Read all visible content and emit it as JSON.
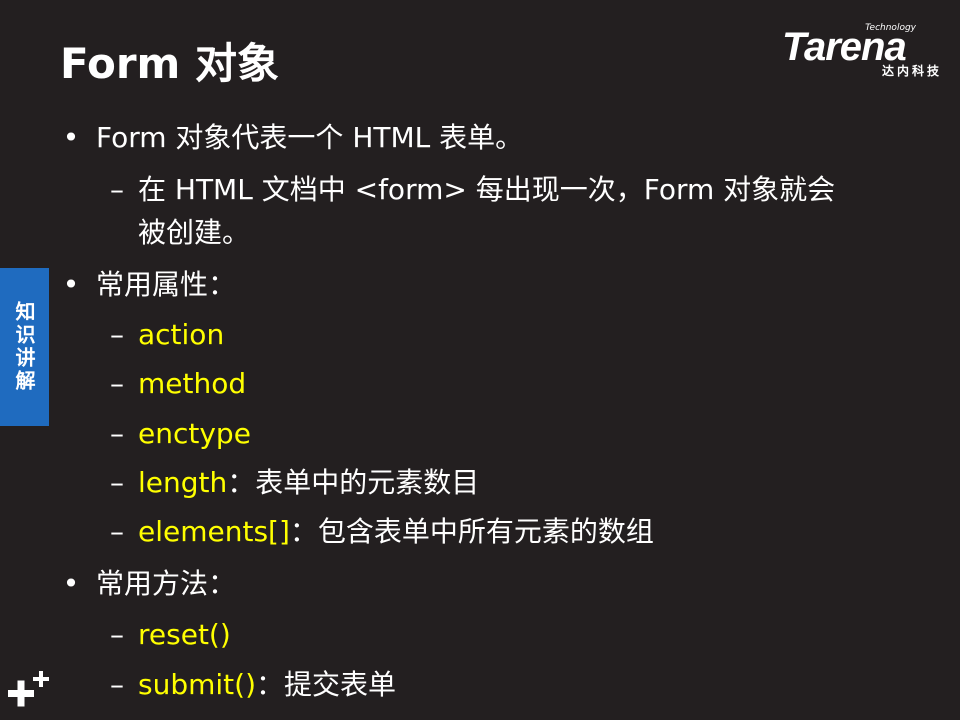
{
  "slide": {
    "title": "Form 对象",
    "side_tab": "知识讲解",
    "logo": {
      "tech": "Technology",
      "word": "Tarena",
      "sub": "达内科技"
    }
  },
  "content": {
    "markers": {
      "bullet": "•",
      "dash": "–"
    },
    "intro": "Form 对象代表一个 HTML 表单。",
    "intro_detail_1": "在 HTML 文档中 <form> 每出现一次，Form 对象就会",
    "intro_detail_2": "被创建。",
    "props_heading": "常用属性：",
    "properties": [
      {
        "name": "action",
        "desc": ""
      },
      {
        "name": "method",
        "desc": ""
      },
      {
        "name": "enctype",
        "desc": ""
      },
      {
        "name": "length",
        "desc": "：表单中的元素数目"
      },
      {
        "name": "elements[]",
        "desc": "：包含表单中所有元素的数组"
      }
    ],
    "methods_heading": "常用方法：",
    "methods": [
      {
        "name": "reset()",
        "desc": ""
      },
      {
        "name": "submit()",
        "desc": "：提交表单"
      }
    ]
  },
  "colors": {
    "background": "#231f20",
    "text": "#ffffff",
    "keyword": "#ffff00",
    "side_tab": "#1f6bbf"
  }
}
